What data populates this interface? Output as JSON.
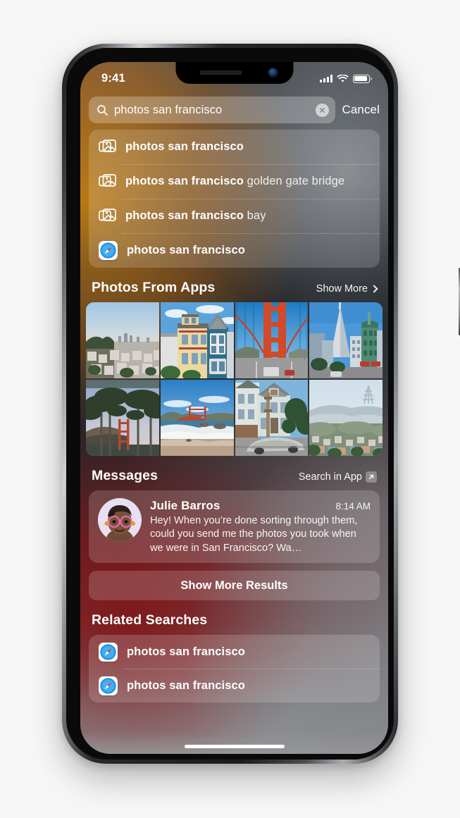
{
  "status_bar": {
    "time": "9:41",
    "signal_icon": "cellular-bars-icon",
    "wifi_icon": "wifi-icon",
    "battery_icon": "battery-icon"
  },
  "search": {
    "icon": "search-icon",
    "value": "photos san francisco",
    "placeholder": "Search",
    "clear_icon": "clear-circle-icon",
    "cancel_label": "Cancel"
  },
  "suggestions": [
    {
      "icon": "photos-stack-icon",
      "matched": "photos san francisco",
      "completion": ""
    },
    {
      "icon": "photos-stack-icon",
      "matched": "photos san francisco",
      "completion": " golden gate bridge"
    },
    {
      "icon": "photos-stack-icon",
      "matched": "photos san francisco",
      "completion": " bay"
    },
    {
      "icon": "safari-icon",
      "matched": "photos san francisco",
      "completion": ""
    }
  ],
  "photos_section": {
    "title": "Photos From Apps",
    "action_label": "Show More",
    "action_icon": "chevron-right-icon",
    "photos": [
      {
        "alt": "san-francisco-hills-cityscape-at-dusk"
      },
      {
        "alt": "victorian-painted-lady-houses"
      },
      {
        "alt": "golden-gate-bridge-tower-from-roadway"
      },
      {
        "alt": "columbus-tower-and-transamerica-pyramid"
      },
      {
        "alt": "cypress-trees-framing-golden-gate-bridge"
      },
      {
        "alt": "baker-beach-with-golden-gate-bridge"
      },
      {
        "alt": "victorian-house-with-covered-car-on-hill"
      },
      {
        "alt": "foggy-twin-peaks-and-sutro-tower"
      }
    ]
  },
  "messages_section": {
    "title": "Messages",
    "action_label": "Search in App",
    "action_icon": "arrow-up-right-box-icon",
    "message": {
      "avatar_icon": "memoji-avatar",
      "sender": "Julie Barros",
      "time": "8:14 AM",
      "preview": "Hey! When you’re done sorting through them, could you send me the photos you took when we were in San Francisco? Wa…"
    }
  },
  "show_more_results": {
    "label": "Show More Results"
  },
  "related_section": {
    "title": "Related Searches",
    "items": [
      {
        "icon": "safari-icon",
        "label": "photos san francisco"
      },
      {
        "icon": "safari-icon",
        "label": "photos san francisco"
      }
    ]
  },
  "home_indicator": "home-indicator",
  "device": {
    "notch_speaker_icon": "earpiece-speaker",
    "notch_camera_icon": "front-camera",
    "buttons": [
      "mute-switch",
      "volume-up-button",
      "volume-down-button",
      "power-button"
    ]
  },
  "colors": {
    "accent_orange": "#f59e14",
    "accent_red": "#961a1c",
    "safari_blue": "#1f9bf0",
    "safari_needle_red": "#ee3b30"
  }
}
